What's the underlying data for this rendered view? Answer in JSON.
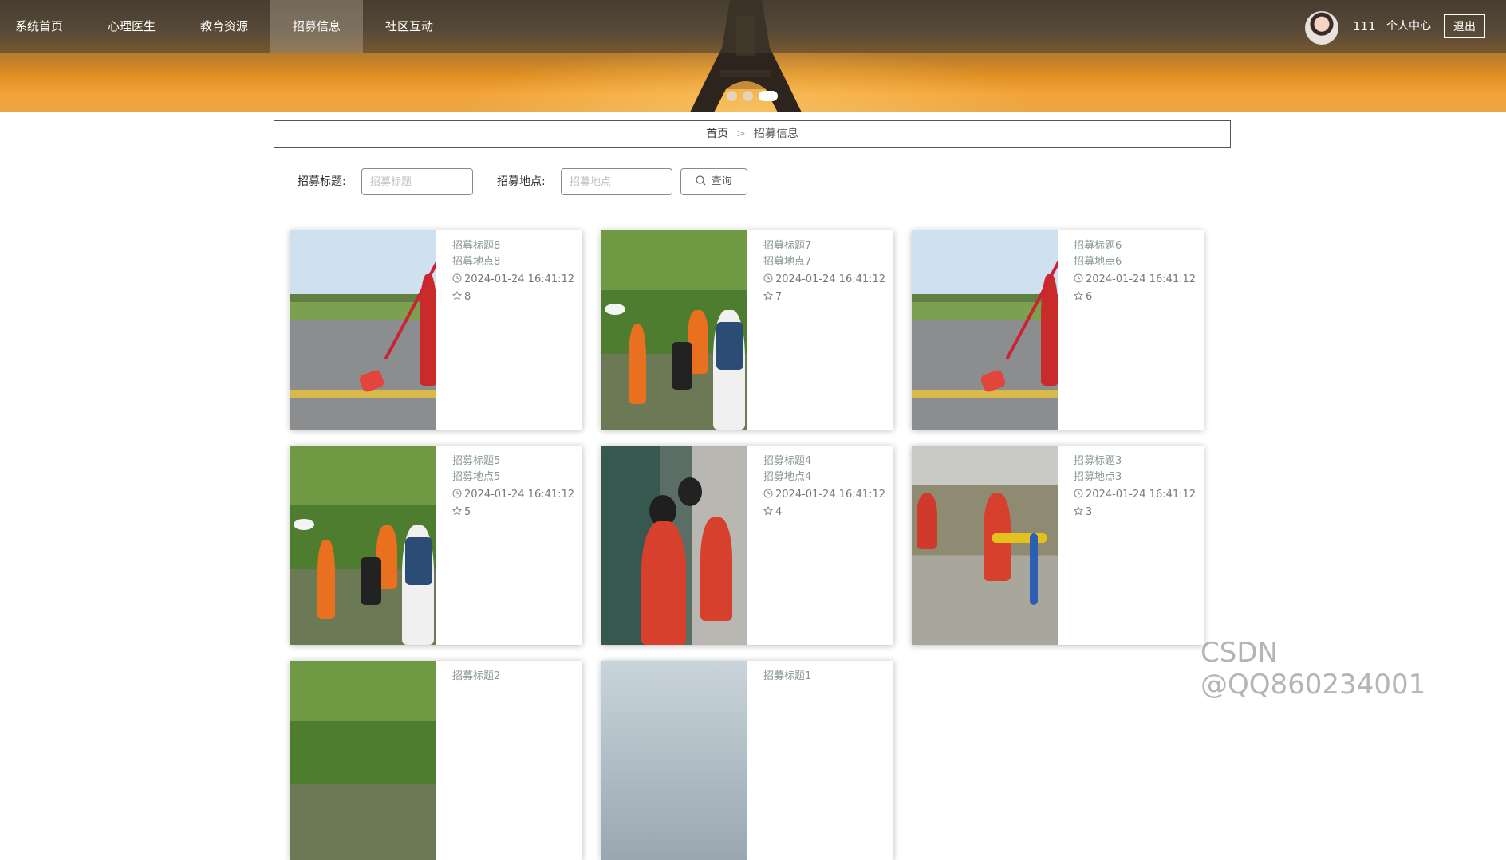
{
  "nav": {
    "items": [
      "系统首页",
      "心理医生",
      "教育资源",
      "招募信息",
      "社区互动"
    ],
    "active_index": 3,
    "username": "111",
    "user_center": "个人中心",
    "logout": "退出"
  },
  "carousel": {
    "dots": 3,
    "active_dot": 3
  },
  "breadcrumb": {
    "home": "首页",
    "separator": ">",
    "current": "招募信息"
  },
  "search": {
    "title_label": "招募标题:",
    "title_placeholder": "招募标题",
    "location_label": "招募地点:",
    "location_placeholder": "招募地点",
    "button": "查询"
  },
  "cards": [
    {
      "title": "招募标题8",
      "location": "招募地点8",
      "time": "2024-01-24 16:41:12",
      "favorites": "8",
      "photo": "road-sweeping"
    },
    {
      "title": "招募标题7",
      "location": "招募地点7",
      "time": "2024-01-24 16:41:12",
      "favorites": "7",
      "photo": "kids-bush"
    },
    {
      "title": "招募标题6",
      "location": "招募地点6",
      "time": "2024-01-24 16:41:12",
      "favorites": "6",
      "photo": "road-sweeping"
    },
    {
      "title": "招募标题5",
      "location": "招募地点5",
      "time": "2024-01-24 16:41:12",
      "favorites": "5",
      "photo": "kids-bush"
    },
    {
      "title": "招募标题4",
      "location": "招募地点4",
      "time": "2024-01-24 16:41:12",
      "favorites": "4",
      "photo": "door-volunteers"
    },
    {
      "title": "招募标题3",
      "location": "招募地点3",
      "time": "2024-01-24 16:41:12",
      "favorites": "3",
      "photo": "park-volunteers"
    },
    {
      "title": "招募标题2",
      "photo": "partial"
    },
    {
      "title": "招募标题1",
      "photo": "partial"
    }
  ],
  "watermark": "CSDN @QQ860234001",
  "icons": {
    "clock": "clock-icon",
    "star": "star-icon",
    "search": "search-icon"
  }
}
